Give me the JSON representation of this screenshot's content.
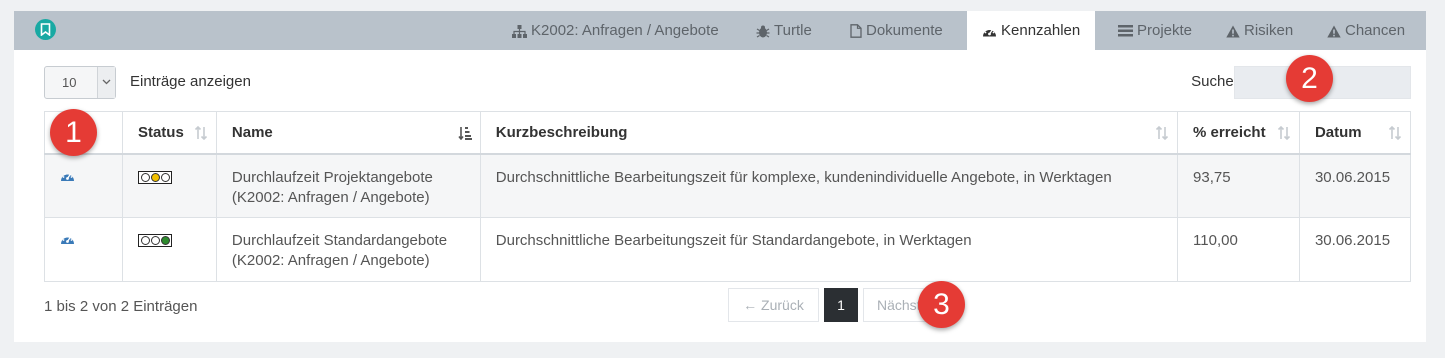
{
  "tabs": [
    {
      "label": "K2002: Anfragen / Angebote",
      "icon": "sitemap-icon"
    },
    {
      "label": "Turtle",
      "icon": "bug-icon"
    },
    {
      "label": "Dokumente",
      "icon": "file-icon"
    },
    {
      "label": "Kennzahlen",
      "icon": "dashboard-icon",
      "active": true
    },
    {
      "label": "Projekte",
      "icon": "list-icon"
    },
    {
      "label": "Risiken",
      "icon": "warning-icon"
    },
    {
      "label": "Chancen",
      "icon": "warning-icon"
    }
  ],
  "length_menu": {
    "value": "10",
    "label": "Einträge anzeigen"
  },
  "search": {
    "label": "Suchen",
    "value": ""
  },
  "table": {
    "columns": [
      "",
      "Status",
      "Name",
      "Kurzbeschreibung",
      "% erreicht",
      "Datum"
    ],
    "rows": [
      {
        "icon": "dashboard-icon",
        "status": {
          "lights": [
            "#ffffff",
            "#f2c100",
            "#ffffff"
          ]
        },
        "name": "Durchlaufzeit Projektangebote\n(K2002: Anfragen / Angebote)",
        "name_line1": "Durchlaufzeit Projektangebote",
        "name_line2": "(K2002: Anfragen / Angebote)",
        "description": "Durchschnittliche Bearbeitungszeit für komplexe, kundenindividuelle Angebote, in Werktagen",
        "achieved": "93,75",
        "date": "30.06.2015"
      },
      {
        "icon": "dashboard-icon",
        "status": {
          "lights": [
            "#ffffff",
            "#ffffff",
            "#2e8b2e"
          ]
        },
        "name_line1": "Durchlaufzeit Standardangebote",
        "name_line2": "(K2002: Anfragen / Angebote)",
        "description": "Durchschnittliche Bearbeitungszeit für Standardangebote, in Werktagen",
        "achieved": "110,00",
        "date": "30.06.2015"
      }
    ]
  },
  "info": "1 bis 2 von 2 Einträgen",
  "pagination": {
    "prev": "← Zurück",
    "page": "1",
    "next": "Nächste"
  },
  "callouts": [
    "1",
    "2",
    "3"
  ],
  "colors": {
    "tabbar": "#b9c2cb",
    "accent": "#19a9a3",
    "callout": "#e53b35",
    "gauge": "#3a7ab8"
  }
}
